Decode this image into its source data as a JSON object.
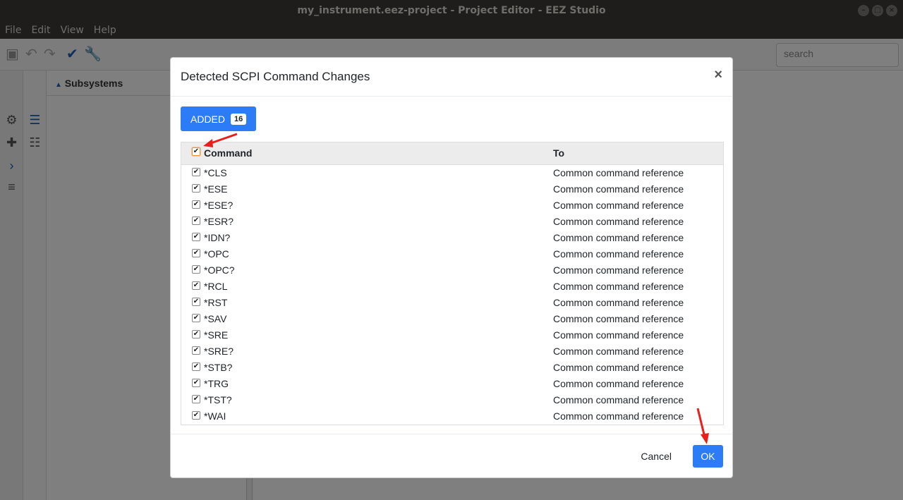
{
  "window": {
    "title": "my_instrument.eez-project - Project Editor - EEZ Studio"
  },
  "menu": [
    "File",
    "Edit",
    "View",
    "Help"
  ],
  "toolbar": {
    "search_placeholder": "search"
  },
  "sidebar": {
    "subsystems_label": "Subsystems"
  },
  "dialog": {
    "title": "Detected SCPI Command Changes",
    "tab": {
      "label": "ADDED",
      "count": "16"
    },
    "columns": {
      "command": "Command",
      "to": "To"
    },
    "rows": [
      {
        "command": "*CLS",
        "to": "Common command reference"
      },
      {
        "command": "*ESE",
        "to": "Common command reference"
      },
      {
        "command": "*ESE?",
        "to": "Common command reference"
      },
      {
        "command": "*ESR?",
        "to": "Common command reference"
      },
      {
        "command": "*IDN?",
        "to": "Common command reference"
      },
      {
        "command": "*OPC",
        "to": "Common command reference"
      },
      {
        "command": "*OPC?",
        "to": "Common command reference"
      },
      {
        "command": "*RCL",
        "to": "Common command reference"
      },
      {
        "command": "*RST",
        "to": "Common command reference"
      },
      {
        "command": "*SAV",
        "to": "Common command reference"
      },
      {
        "command": "*SRE",
        "to": "Common command reference"
      },
      {
        "command": "*SRE?",
        "to": "Common command reference"
      },
      {
        "command": "*STB?",
        "to": "Common command reference"
      },
      {
        "command": "*TRG",
        "to": "Common command reference"
      },
      {
        "command": "*TST?",
        "to": "Common command reference"
      },
      {
        "command": "*WAI",
        "to": "Common command reference"
      }
    ],
    "cancel_label": "Cancel",
    "ok_label": "OK"
  },
  "colors": {
    "accent": "#2b7cf6",
    "annotation": "#e8201c"
  }
}
